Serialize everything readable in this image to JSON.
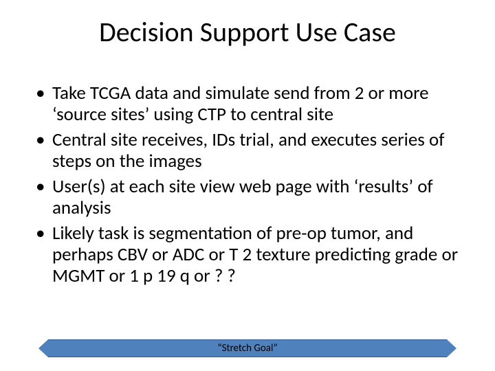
{
  "title": "Decision Support Use Case",
  "bullets": [
    "Take TCGA data and simulate send from 2 or more ‘source sites’ using CTP to central site",
    "Central site receives, IDs trial, and executes series of steps on the images",
    "User(s) at each site view web page with ‘results’ of analysis",
    "Likely task is segmentation of pre-op tumor, and perhaps CBV or ADC or T 2 texture predicting grade or MGMT or 1 p 19 q or ? ?"
  ],
  "banner": {
    "label": "“Stretch Goal”"
  }
}
